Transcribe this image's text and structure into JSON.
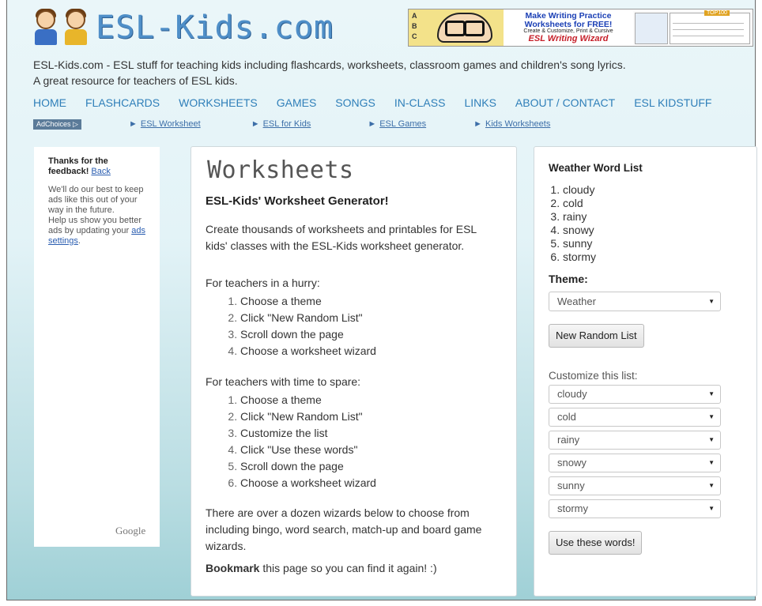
{
  "header": {
    "logo_text": "ESL-Kids.com",
    "banner": {
      "letters": [
        "A",
        "B",
        "C"
      ],
      "line1": "Make Writing Practice",
      "line2": "Worksheets for FREE!",
      "line3": "Create & Customize, Print & Cursive",
      "line4": "ESL Writing Wizard",
      "tag": "TOP100"
    },
    "tagline_1": "ESL-Kids.com - ESL stuff for teaching kids including flashcards, worksheets, classroom games and children's song lyrics.",
    "tagline_2": "A great resource for teachers of ESL kids."
  },
  "nav": [
    "HOME",
    "FLASHCARDS",
    "WORKSHEETS",
    "GAMES",
    "SONGS",
    "IN-CLASS",
    "LINKS",
    "ABOUT / CONTACT",
    "ESL KIDSTUFF"
  ],
  "adbar": {
    "adchoices": "AdChoices",
    "links": [
      "ESL Worksheet",
      "ESL for Kids",
      "ESL Games",
      "Kids Worksheets"
    ]
  },
  "ad_feedback": {
    "thanks": "Thanks for the feedback!",
    "back": "Back",
    "line1": "We'll do our best to keep ads like this out of your way in the future.",
    "line2": "Help us show you better ads by updating your",
    "ads_settings": "ads settings",
    "period": ".",
    "google": "Google"
  },
  "main": {
    "title": "Worksheets",
    "subtitle": "ESL-Kids' Worksheet Generator!",
    "intro": "Create thousands of worksheets and printables for ESL kids' classes with the ESL-Kids worksheet generator.",
    "hurry_heading": "For teachers in a hurry:",
    "hurry_steps": [
      "Choose a theme",
      "Click \"New Random List\"",
      "Scroll down the page",
      "Choose a worksheet wizard"
    ],
    "spare_heading": "For teachers with time to spare:",
    "spare_steps": [
      "Choose a theme",
      "Click \"New Random List\"",
      "Customize the list",
      "Click \"Use these words\"",
      "Scroll down the page",
      "Choose a worksheet wizard"
    ],
    "wizards_text": "There are over a dozen wizards below to choose from including bingo, word search, match-up and board game wizards.",
    "bookmark_bold": "Bookmark",
    "bookmark_rest": " this page so you can find it again! :)"
  },
  "sidebar": {
    "word_list_title": "Weather Word List",
    "words": [
      "cloudy",
      "cold",
      "rainy",
      "snowy",
      "sunny",
      "stormy"
    ],
    "theme_label": "Theme:",
    "theme_value": "Weather",
    "new_random_label": "New Random List",
    "customize_label": "Customize this list:",
    "custom_values": [
      "cloudy",
      "cold",
      "rainy",
      "snowy",
      "sunny",
      "stormy"
    ],
    "use_words_label": "Use these words!"
  }
}
